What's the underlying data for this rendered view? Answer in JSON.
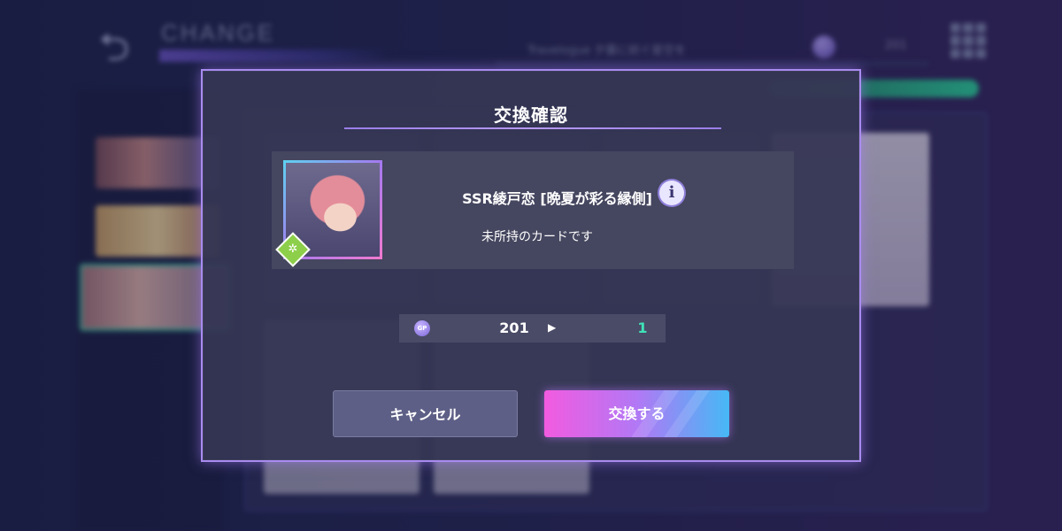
{
  "background": {
    "screen_title": "CHANGE",
    "header_subtitle": "Travelogue 夕暮に紡ぐ星空を",
    "header_currency_count": "201"
  },
  "modal": {
    "title": "交換確認",
    "card": {
      "name": "SSR綾戸恋 [晩夏が彩る縁側]",
      "status": "未所持のカードです",
      "info_icon": "i"
    },
    "exchange": {
      "currency_icon": "GP",
      "from": "201",
      "arrow": "▶",
      "to": "1"
    },
    "buttons": {
      "cancel": "キャンセル",
      "confirm": "交換する"
    }
  },
  "colors": {
    "modal_border": "#a98bf0",
    "remaining_value": "#3fe3b8",
    "confirm_gradient_start": "#f25be0",
    "confirm_gradient_end": "#46b8f5",
    "attribute_badge": "#8dcf4a"
  }
}
